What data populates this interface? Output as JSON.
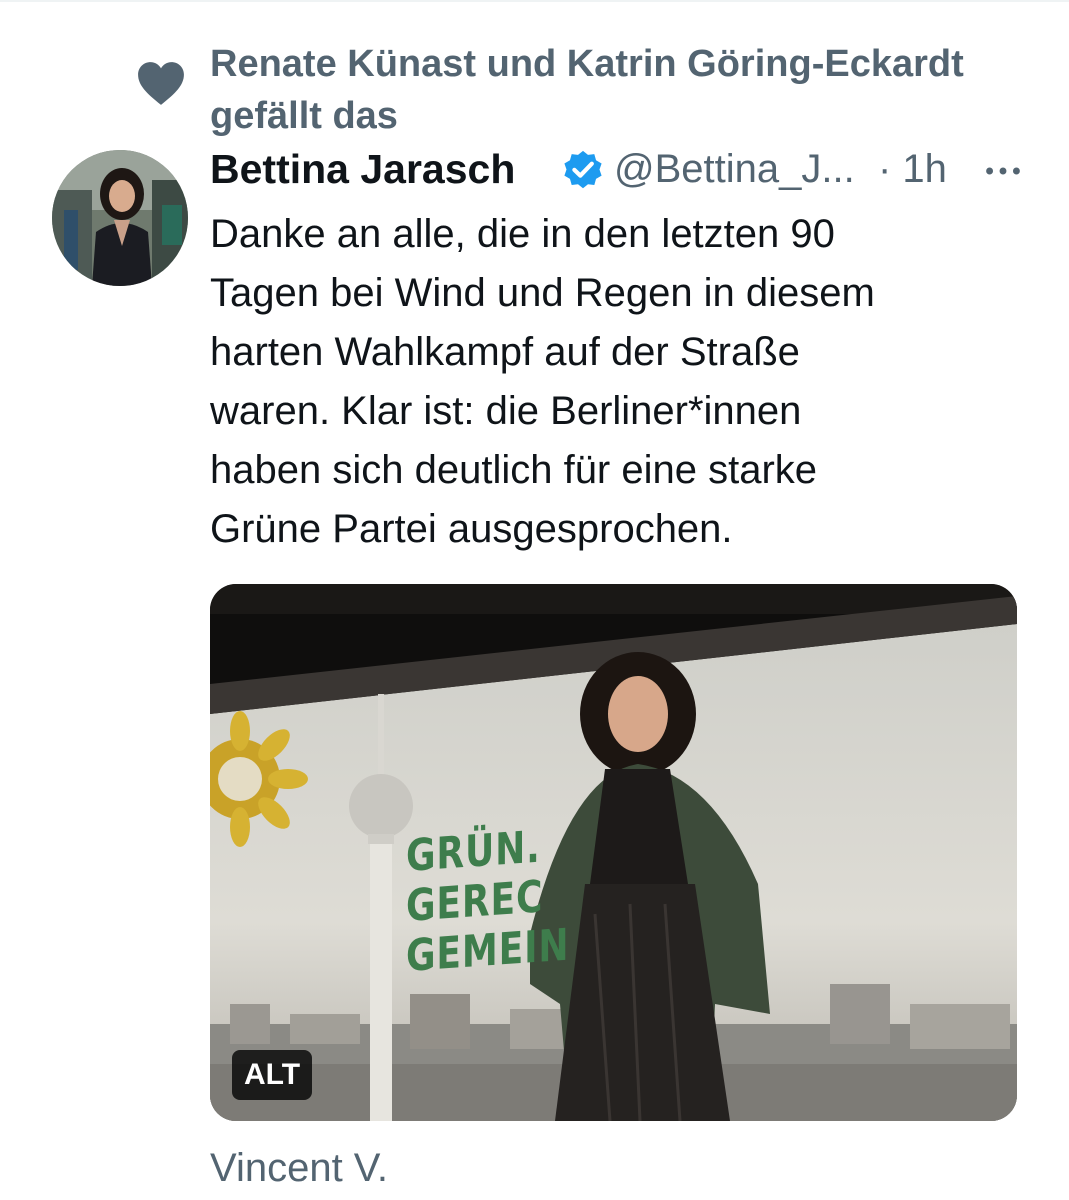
{
  "social_context": {
    "icon": "heart-icon",
    "text": "Renate Künast und Katrin Göring-Eckardt gefällt das"
  },
  "tweet": {
    "author_name": "Bettina Jarasch",
    "verified_icon": "verified-badge-icon",
    "handle": "@Bettina_J...",
    "timestamp": "· 1h",
    "more_icon": "more-horizontal-icon",
    "text": "Danke an alle, die in den letzten 90\nTagen bei Wind und Regen in diesem\nharten Wahlkampf auf der Straße\nwaren. Klar ist: die Berliner*innen\nhaben sich deutlich für eine starke\nGrüne Partei ausgesprochen.",
    "media": {
      "slogan_line1": "GRÜN.",
      "slogan_line2": "GEREC",
      "slogan_line3": "GEMEIN",
      "alt_badge": "ALT"
    }
  },
  "next_item": {
    "author": "Vincent V."
  },
  "colors": {
    "secondary_text": "#536471",
    "primary_text": "#0f1419",
    "verified_blue": "#1d9bf0",
    "slogan_green": "#3e7d4c"
  }
}
